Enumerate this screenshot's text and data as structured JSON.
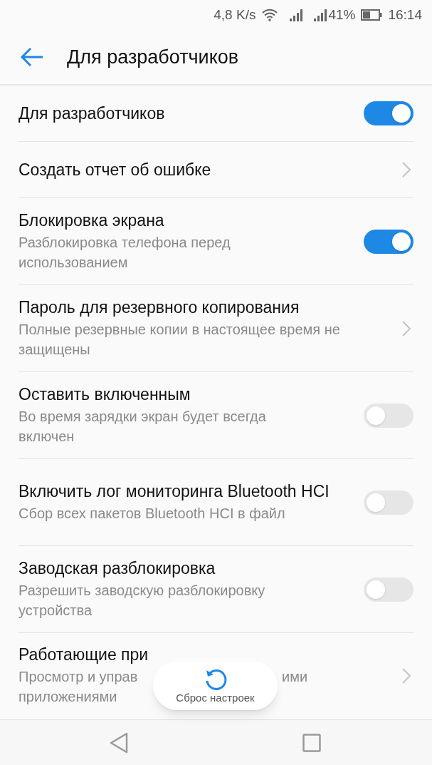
{
  "status_bar": {
    "speed": "4,8 K/s",
    "battery_percent": "41%",
    "time": "16:14"
  },
  "header": {
    "title": "Для разработчиков"
  },
  "items": [
    {
      "kind": "toggle",
      "title": "Для разработчиков",
      "on": true
    },
    {
      "kind": "link",
      "title": "Создать отчет об ошибке"
    },
    {
      "kind": "toggle",
      "title": "Блокировка экрана",
      "subtitle": "Разблокировка телефона перед использованием",
      "on": true
    },
    {
      "kind": "link",
      "title": "Пароль для резервного копирования",
      "subtitle": "Полные резервные копии в настоящее время не защищены"
    },
    {
      "kind": "toggle",
      "title": "Оставить включенным",
      "subtitle": "Во время зарядки экран будет всегда включен",
      "on": false
    },
    {
      "kind": "toggle",
      "title": "Включить лог мониторинга Bluetooth HCI",
      "subtitle": "Сбор всех пакетов Bluetooth HCI в файл",
      "on": false
    },
    {
      "kind": "toggle",
      "title": "Заводская разблокировка",
      "subtitle": "Разрешить заводскую разблокировку устройства",
      "on": false
    },
    {
      "kind": "partial",
      "title": "Работающие при",
      "subtitle_fragments": [
        "Просмотр и управ",
        "ими"
      ],
      "subtitle_line2": "приложениями"
    }
  ],
  "toast": {
    "text": "Сброс настроек"
  }
}
